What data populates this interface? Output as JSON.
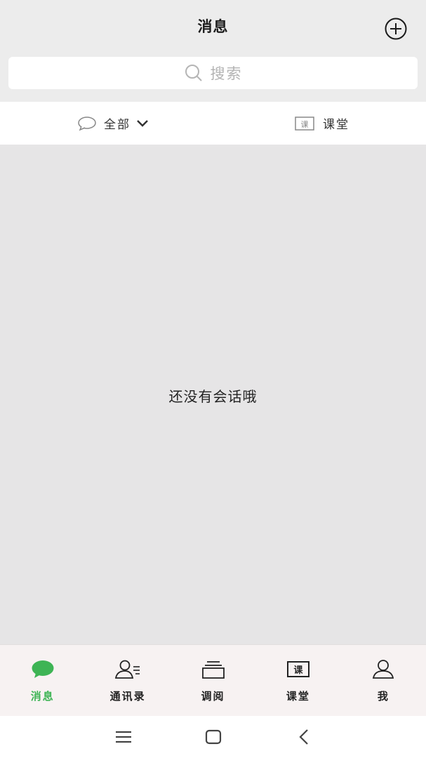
{
  "header": {
    "title": "消息",
    "add_icon": "plus-circle-icon"
  },
  "search": {
    "placeholder": "搜索",
    "icon": "search-icon"
  },
  "filters": {
    "all_label": "全部",
    "class_label": "课堂",
    "class_icon_text": "课"
  },
  "empty_state": {
    "message": "还没有会话哦"
  },
  "tabbar": {
    "active_color": "#3eb455",
    "items": [
      {
        "label": "消息",
        "icon": "chat-bubble-icon",
        "active": true
      },
      {
        "label": "通讯录",
        "icon": "contacts-icon",
        "active": false
      },
      {
        "label": "调阅",
        "icon": "stack-icon",
        "active": false
      },
      {
        "label": "课堂",
        "icon": "class-icon",
        "icon_text": "课",
        "active": false
      },
      {
        "label": "我",
        "icon": "person-icon",
        "active": false
      }
    ]
  },
  "system_nav": {
    "items": [
      "menu-icon",
      "home-icon",
      "back-icon"
    ]
  }
}
